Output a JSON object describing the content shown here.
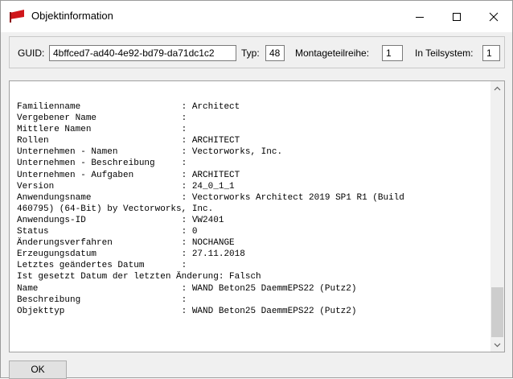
{
  "window": {
    "title": "Objektinformation",
    "controls": {
      "minimize": "—",
      "maximize": "☐",
      "close": "✕"
    }
  },
  "guid_bar": {
    "guid_label": "GUID:",
    "guid_value": "4bffced7-ad40-4e92-bd79-da71dc1c2",
    "typ_label": "Typ:",
    "typ_value": "48",
    "montage_label": "Montageteilreihe:",
    "montage_value": "1",
    "teilsystem_label": "In Teilsystem:",
    "teilsystem_value": "1"
  },
  "info_lines": [
    "Familienname                   : Architect",
    "Vergebener Name                :",
    "Mittlere Namen                 :",
    "Rollen                         : ARCHITECT",
    "Unternehmen - Namen            : Vectorworks, Inc.",
    "Unternehmen - Beschreibung     :",
    "Unternehmen - Aufgaben         : ARCHITECT",
    "Version                        : 24_0_1_1",
    "Anwendungsname                 : Vectorworks Architect 2019 SP1 R1 (Build",
    "460795) (64-Bit) by Vectorworks, Inc.",
    "Anwendungs-ID                  : VW2401",
    "Status                         : 0",
    "Änderungsverfahren             : NOCHANGE",
    "Erzeugungsdatum                : 27.11.2018",
    "Letztes geändertes Datum       :",
    "Ist gesetzt Datum der letzten Änderung: Falsch",
    "Name                           : WAND Beton25 DaemmEPS22 (Putz2)",
    "Beschreibung                   :",
    "Objekttyp                      : WAND Beton25 DaemmEPS22 (Putz2)"
  ],
  "buttons": {
    "ok": "OK"
  },
  "icons": {
    "app": "red-flag-icon",
    "scroll_up": "chevron-up-icon",
    "scroll_down": "chevron-down-icon"
  }
}
